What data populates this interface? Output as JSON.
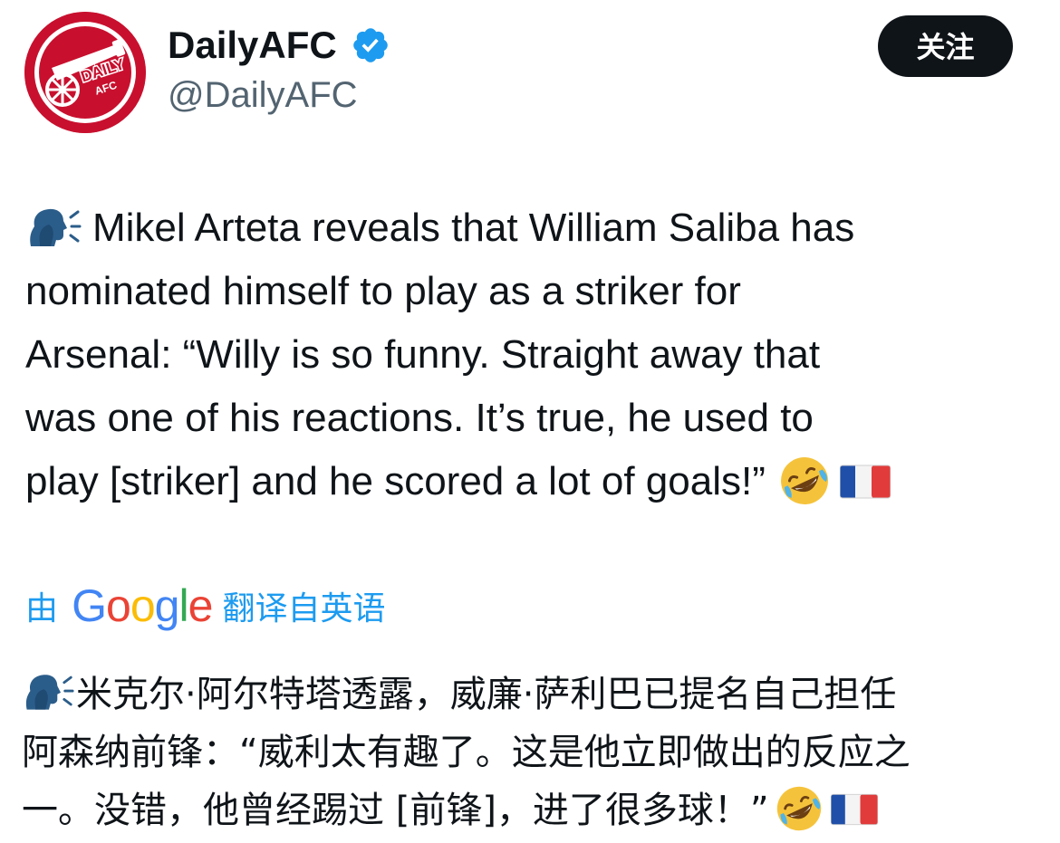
{
  "author": {
    "display_name": "DailyAFC",
    "handle": "@DailyAFC",
    "verified": true,
    "avatar_text_top": "DAILY",
    "avatar_text_bottom": "AFC"
  },
  "follow_button": {
    "label": "关注"
  },
  "tweet": {
    "lines": [
      "Mikel Arteta reveals that William Saliba has",
      "nominated himself to play as a striker for",
      "Arsenal: “Willy is so funny. Straight away that",
      "was one of his reactions. It’s true, he used to",
      "play [striker] and he scored a lot of goals!”"
    ],
    "emojis": [
      "speaking-head-icon",
      "rofl-emoji-icon",
      "france-flag-icon"
    ]
  },
  "translation": {
    "by_label": "由",
    "google_letters": [
      "G",
      "o",
      "o",
      "g",
      "l",
      "e"
    ],
    "google_colors": [
      "#4285F4",
      "#EA4335",
      "#FBBC05",
      "#4285F4",
      "#34A853",
      "#EA4335"
    ],
    "from_label": "翻译自英语",
    "lines": [
      "米克尔·阿尔特塔透露，威廉·萨利巴已提名自己担任",
      "阿森纳前锋：“威利太有趣了。这是他立即做出的反应之",
      "一。没错，他曾经踢过 [前锋]，进了很多球！”"
    ]
  },
  "colors": {
    "text": "#0f1419",
    "secondary_text": "#536471",
    "accent": "#1d9bf0",
    "button_bg": "#0f1419",
    "avatar_red": "#c8102e"
  }
}
